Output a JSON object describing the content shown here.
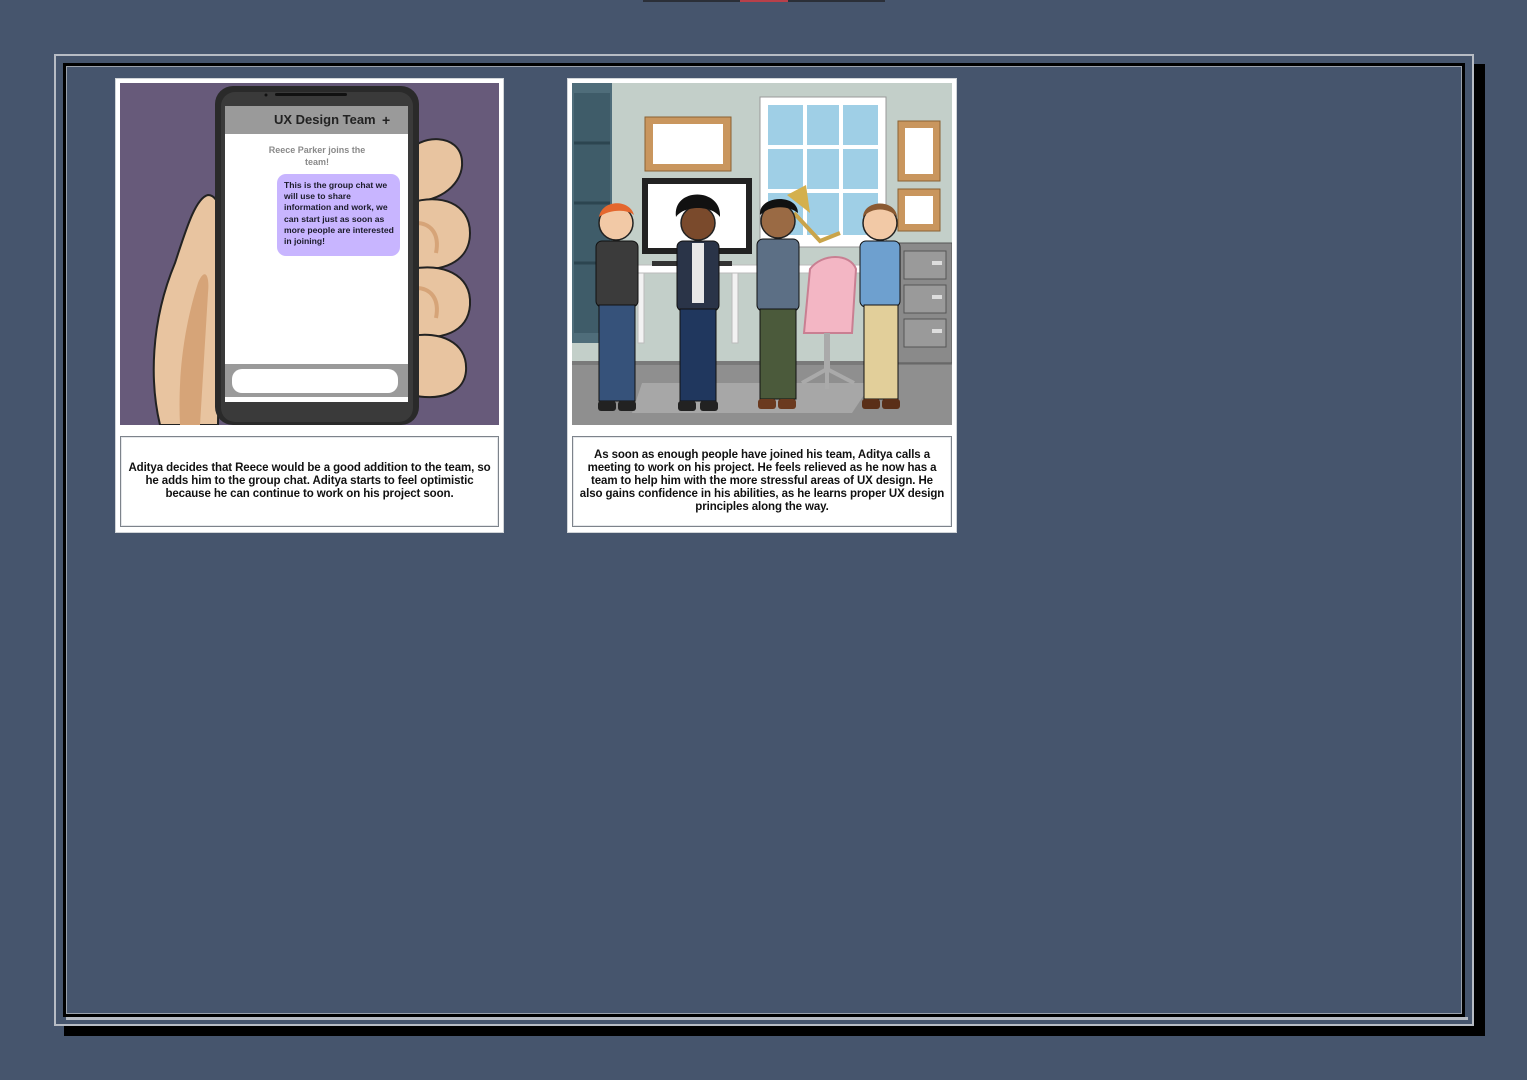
{
  "storyboard": {
    "cells": [
      {
        "phone": {
          "chat_title": "UX Design Team",
          "add_symbol": "+",
          "join_note": "Reece Parker joins the team!",
          "message": "This is the group chat we will use to share information and work, we can start just as soon as more people are interested in joining!"
        },
        "caption": "Aditya decides that Reece would be a good addition to the team, so he adds him to the group chat. Aditya starts to feel optimistic because he can continue to work on his project soon."
      },
      {
        "caption": "As soon as enough people have joined his team, Aditya calls a meeting to work on his project. He feels relieved as he now has a team to help him with the more stressful areas of UX design. He also gains confidence in his abilities, as he learns proper UX design principles along the way."
      }
    ]
  },
  "colors": {
    "page_background": "#46556d",
    "chat_bubble": "#c8b5ff",
    "scene1_background": "#675a7a",
    "office_wall": "#c3cfc9"
  }
}
